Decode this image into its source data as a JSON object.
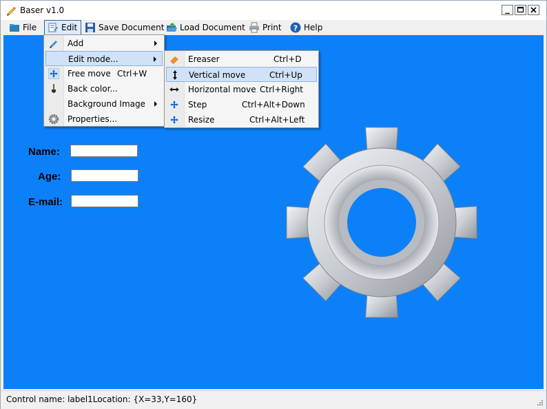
{
  "window": {
    "title": "Baser v1.0",
    "app_icon": "pencil-icon"
  },
  "controls": {
    "minimize": "minimize-icon",
    "maximize": "maximize-icon",
    "close": "close-icon"
  },
  "menubar": {
    "file": "File",
    "edit": "Edit",
    "save": "Save Document",
    "load": "Load Document",
    "print": "Print",
    "help": "Help"
  },
  "edit_menu": {
    "items": [
      {
        "label": "Add",
        "icon": "pencil-icon",
        "has_submenu": true
      },
      {
        "label": "Edit mode...",
        "icon": "",
        "has_submenu": true,
        "highlighted": true
      },
      {
        "label": "Free move",
        "shortcut": "Ctrl+W",
        "icon": "move-arrows-icon"
      },
      {
        "label": "Back color...",
        "icon": "brush-icon"
      },
      {
        "label": "Background Image",
        "icon": "",
        "has_submenu": true
      },
      {
        "label": "Properties...",
        "icon": "gear-icon"
      }
    ]
  },
  "edit_mode_menu": {
    "items": [
      {
        "label": "Ereaser",
        "shortcut": "Ctrl+D",
        "icon": "eraser-icon"
      },
      {
        "label": "Vertical move",
        "shortcut": "Ctrl+Up",
        "icon": "vertical-arrow-icon",
        "highlighted": true
      },
      {
        "label": "Horizontal move",
        "shortcut": "Ctrl+Right",
        "icon": "horizontal-arrow-icon"
      },
      {
        "label": "Step",
        "shortcut": "Ctrl+Alt+Down",
        "icon": "move-arrows-icon"
      },
      {
        "label": "Resize",
        "shortcut": "Ctrl+Alt+Left",
        "icon": "move-arrows-icon"
      }
    ]
  },
  "form": {
    "name_label": "Name:",
    "age_label": "Age:",
    "email_label": "E-mail:",
    "name_value": "",
    "age_value": "",
    "email_value": ""
  },
  "canvas": {
    "background": "#0c80f8",
    "image": "gear-icon"
  },
  "status": {
    "text": "Control name: label1Location: {X=33,Y=160}"
  }
}
